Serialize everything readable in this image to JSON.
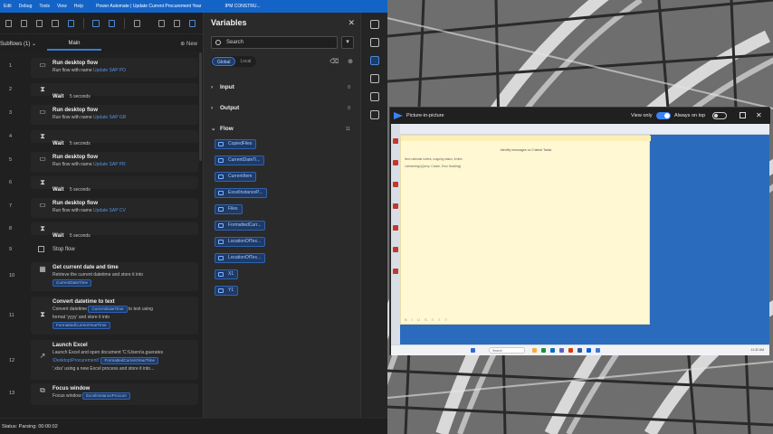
{
  "titlebar": {
    "menus": [
      "Edit",
      "Debug",
      "Tools",
      "View",
      "Help"
    ],
    "app_title": "Power Automate | Update Current Procurement Year",
    "second_title": "IPM CONSTRU..."
  },
  "subtabs": {
    "subflows": "Subflows (1) ⌄",
    "main": "Main",
    "new": "New"
  },
  "flow": [
    {
      "num": "1",
      "title": "Run desktop flow",
      "text": "Run flow with name ",
      "link": "Update SAP PO",
      "icon": "desktop-flow-icon"
    },
    {
      "num": "2",
      "title": "Wait",
      "text": "5 seconds",
      "icon": "hourglass-icon"
    },
    {
      "num": "3",
      "title": "Run desktop flow",
      "text": "Run flow with name ",
      "link": "Update SAP GR",
      "icon": "desktop-flow-icon"
    },
    {
      "num": "4",
      "title": "Wait",
      "text": "5 seconds",
      "icon": "hourglass-icon"
    },
    {
      "num": "5",
      "title": "Run desktop flow",
      "text": "Run flow with name ",
      "link": "Update SAP PR",
      "icon": "desktop-flow-icon"
    },
    {
      "num": "6",
      "title": "Wait",
      "text": "5 seconds",
      "icon": "hourglass-icon"
    },
    {
      "num": "7",
      "title": "Run desktop flow",
      "text": "Run flow with name ",
      "link": "Update SAP CV",
      "icon": "desktop-flow-icon"
    },
    {
      "num": "8",
      "title": "Wait",
      "text": "5 seconds",
      "icon": "hourglass-icon"
    },
    {
      "num": "9",
      "title": "Stop flow",
      "icon": "stop-icon"
    },
    {
      "num": "10",
      "title": "Get current date and time",
      "text": "Retrieve the current datetime and store it into",
      "chips": [
        "CurrentDateTime"
      ],
      "icon": "calendar-icon"
    },
    {
      "num": "11",
      "title": "Convert datetime to text",
      "line1": "Convert datetime",
      "chip1": "CurrentDateTime",
      "line1b": "to text using",
      "line2": "format 'yyyy' and store it into",
      "chip2": "FormattedCurrentYearTime",
      "icon": "hourglass-icon"
    },
    {
      "num": "12",
      "title": "Launch Excel",
      "line1": "Launch Excel and open document 'C:\\Users\\s.guerates",
      "line2": "\\Desktop\\Procurement\\'",
      "chip1": "FormattedCurrentYearTime",
      "line3": "'.xlsx' using a new Excel process and store it into...",
      "icon": "arrow-icon"
    },
    {
      "num": "13",
      "title": "Focus window",
      "text": "Focus window",
      "chip1": "ExcelInstanceProcure",
      "icon": "window-focus-icon"
    }
  ],
  "status": "Status: Parsing: 00:00:02",
  "variables": {
    "header": "Variables",
    "close": "✕",
    "search_placeholder": "Search",
    "scope_global": "Global",
    "scope_local": "Local",
    "sections": [
      {
        "label": "Input",
        "count": "0"
      },
      {
        "label": "Output",
        "count": "0"
      },
      {
        "label": "Flow",
        "count": "11"
      }
    ],
    "flow_vars": [
      "CopiedFiles",
      "CurrentDateTi...",
      "CurrentItem",
      "ExcelInstanceP...",
      "Files",
      "FormattedCurr...",
      "LocationOfTex...",
      "LocationOfTex...",
      "X1",
      "Y1"
    ]
  },
  "pip": {
    "title": "Picture-in-picture",
    "view_only": "View only",
    "always_on_top": "Always on top",
    "view_only_on": true,
    "always_on_top_on": false
  },
  "remote": {
    "note_title": "Identify messages on 2 latest Tasks",
    "note_line1": "New calendar invites, outgoing status, Invites",
    "note_line2": "Listmeetings(Query: Create, Error Handling)",
    "note_footer": "B  I  U  S  ≡  ≡  ≡",
    "search": "Search",
    "clock": "11:32 AM"
  },
  "colors": {
    "accent": "#3a7bd5",
    "titlebar": "#1464c8",
    "chip_bg": "#1e3a66",
    "note": "#fff8d2"
  }
}
